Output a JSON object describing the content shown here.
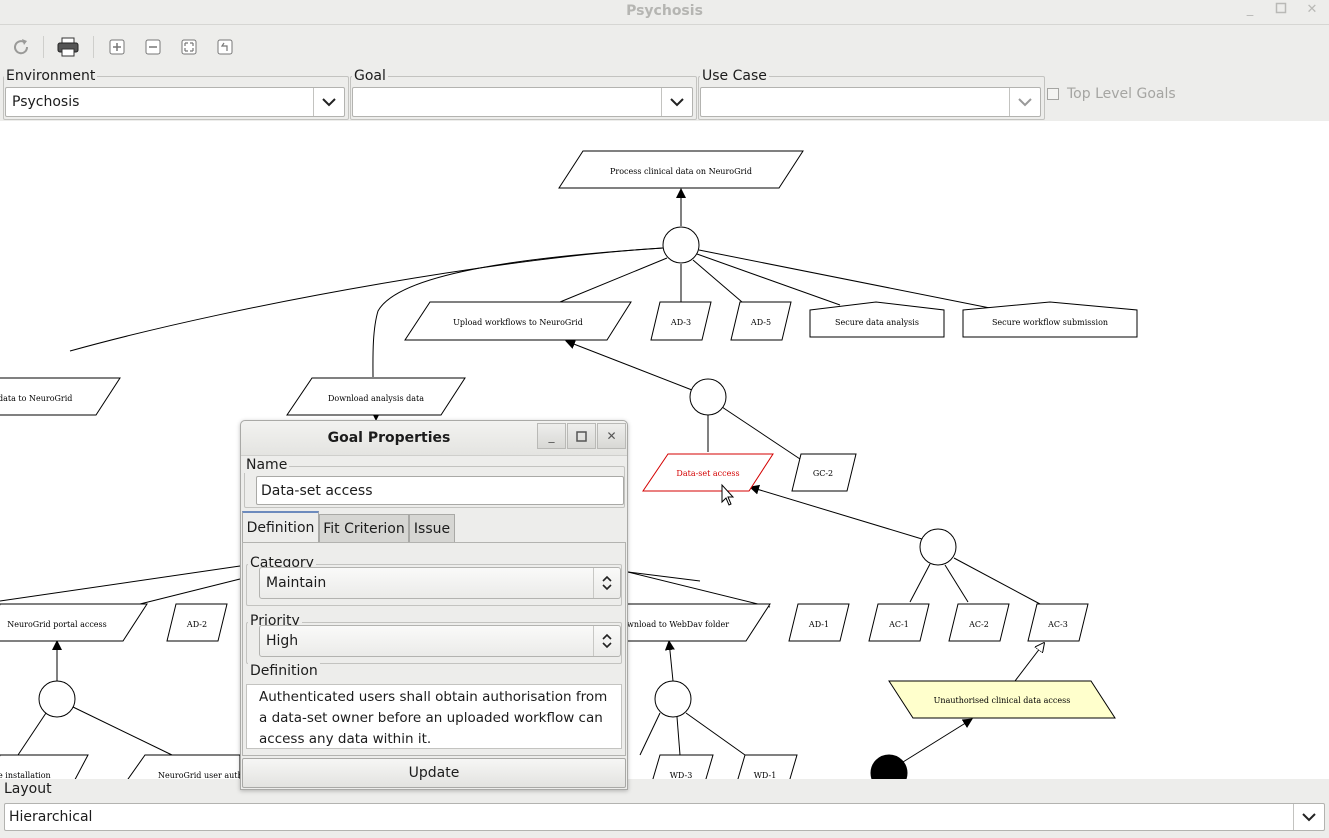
{
  "window": {
    "title": "Psychosis"
  },
  "toolbar": {
    "buttons": [
      "refresh-icon",
      "print-icon",
      "zoom-in-icon",
      "zoom-out-icon",
      "fit-icon",
      "back-icon"
    ]
  },
  "filters": {
    "environment": {
      "label": "Environment",
      "value": "Psychosis"
    },
    "goal": {
      "label": "Goal",
      "value": ""
    },
    "use_case": {
      "label": "Use Case",
      "value": ""
    },
    "top_level_goals": {
      "label": "Top Level Goals",
      "checked": false
    }
  },
  "graph": {
    "nodes": {
      "process_clinical": "Process clinical data on NeuroGrid",
      "upload_workflows": "Upload workflows to NeuroGrid",
      "ad3": "AD-3",
      "ad5": "AD-5",
      "secure_analysis": "Secure data analysis",
      "secure_workflow": "Secure workflow submission",
      "data_to_neurogrid": "data to NeuroGrid",
      "download_analysis": "Download analysis data",
      "dataset_access": "Data-set access",
      "gc2": "GC-2",
      "neurogrid_portal": "NeuroGrid portal access",
      "ad2": "AD-2",
      "download_webdav": "wnload to WebDav folder",
      "ad1": "AD-1",
      "ac1": "AC-1",
      "ac2": "AC-2",
      "ac3": "AC-3",
      "unauthorised": "Unauthorised clinical data access",
      "installation": "e installation",
      "user_auth": "NeuroGrid user autho",
      "wd3": "WD-3",
      "wd1": "WD-1"
    },
    "colors": {
      "selected": "#d40000",
      "obstacle": "#ffffcc"
    }
  },
  "dialog": {
    "title": "Goal Properties",
    "name_label": "Name",
    "name_value": "Data-set access",
    "tabs": [
      "Definition",
      "Fit Criterion",
      "Issue"
    ],
    "active_tab": "Definition",
    "category_label": "Category",
    "category_value": "Maintain",
    "priority_label": "Priority",
    "priority_value": "High",
    "definition_label": "Definition",
    "definition_text": "Authenticated users shall obtain authorisation from a data-set owner before an uploaded workflow can access any data within it.",
    "update_label": "Update"
  },
  "layout": {
    "label": "Layout",
    "value": "Hierarchical"
  }
}
